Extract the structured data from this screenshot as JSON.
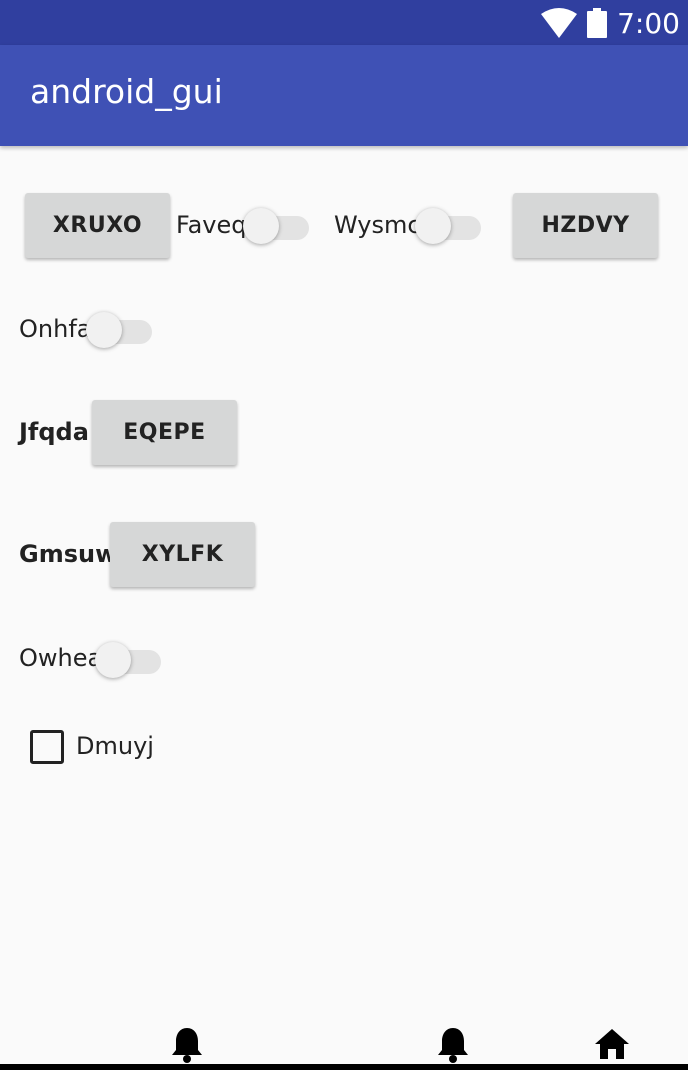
{
  "status_bar": {
    "time": "7:00",
    "icons": [
      "wifi-icon",
      "battery-icon"
    ]
  },
  "app_bar": {
    "title": "android_gui"
  },
  "colors": {
    "status_bar": "#303f9f",
    "app_bar": "#3f51b5",
    "background": "#fafafa",
    "button": "#d6d7d7"
  },
  "row1": {
    "button_left": "XRUXO",
    "switch_1_label": "Faveq",
    "switch_1_on": false,
    "switch_2_label": "Wysmc",
    "switch_2_on": false,
    "button_right": "HZDVY"
  },
  "row2": {
    "switch_label": "Onhfa",
    "switch_on": false
  },
  "row3": {
    "label": "Jfqda",
    "button": "EQEPE"
  },
  "row4": {
    "label": "Gmsuw",
    "button": "XYLFK"
  },
  "row5": {
    "switch_label": "Owhea",
    "switch_on": false
  },
  "row6": {
    "checkbox_label": "Dmuyj",
    "checked": false
  },
  "nav_bar": {
    "icons": [
      "bell-icon",
      "bell-icon",
      "home-icon"
    ]
  }
}
